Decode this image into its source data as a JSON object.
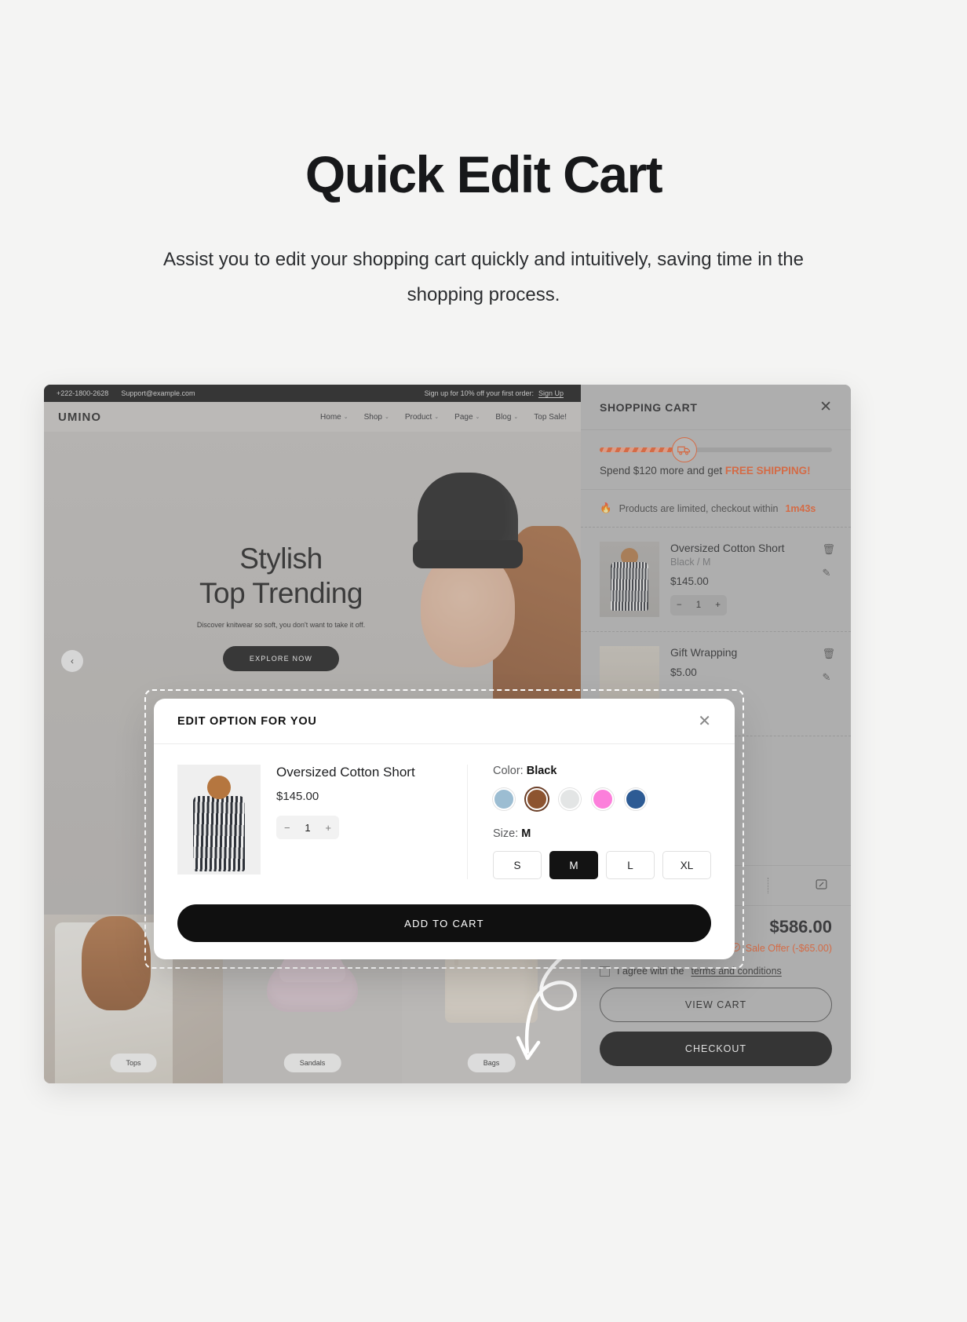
{
  "hero": {
    "title": "Quick Edit Cart",
    "subtitle": "Assist you to edit your shopping cart quickly and intuitively, saving time in the shopping process."
  },
  "site": {
    "topbar": {
      "phone": "+222-1800-2628",
      "email": "Support@example.com",
      "promo": "Sign up for 10% off your first order:",
      "promo_link": "Sign Up"
    },
    "logo": "UMINO",
    "nav": [
      {
        "label": "Home",
        "caret": "⌄"
      },
      {
        "label": "Shop",
        "caret": "⌄"
      },
      {
        "label": "Product",
        "caret": "⌄"
      },
      {
        "label": "Page",
        "caret": "⌄"
      },
      {
        "label": "Blog",
        "caret": "⌄"
      },
      {
        "label": "Top Sale!",
        "caret": ""
      }
    ],
    "hero_slide": {
      "line1": "Stylish",
      "line2": "Top Trending",
      "desc": "Discover knitwear so soft, you don't want to take it off.",
      "cta": "EXPLORE NOW",
      "prev_arrow": "‹"
    },
    "tiles": [
      {
        "label": "Tops"
      },
      {
        "label": "Sandals"
      },
      {
        "label": "Bags"
      }
    ]
  },
  "cart": {
    "title": "SHOPPING CART",
    "close_icon": "✕",
    "shipping": {
      "progress_pct": 34,
      "text_before": "Spend $120 more and get",
      "text_highlight": "FREE SHIPPING!",
      "truck_icon": "truck-icon"
    },
    "limited": {
      "emoji": "🔥",
      "text": "Products are limited, checkout within",
      "timer": "1m43s"
    },
    "items": [
      {
        "name": "Oversized Cotton Short",
        "variant": "Black / M",
        "price": "$145.00",
        "qty": "1",
        "minus": "−",
        "plus": "+",
        "remove_icon": "🗑",
        "edit_icon": "✎"
      },
      {
        "name": "Gift Wrapping",
        "variant": "",
        "price": "$5.00",
        "qty": "",
        "minus": "−",
        "plus": "+",
        "remove_icon": "🗑",
        "edit_icon": "✎"
      }
    ],
    "tools": [
      {
        "icon": "note-icon",
        "glyph": "✎"
      },
      {
        "icon": "box-icon",
        "glyph": "⬡"
      },
      {
        "icon": "coupon-icon",
        "glyph": "▣"
      }
    ],
    "total": "$586.00",
    "sale_offer": "Sale Offer (-$65.00)",
    "sale_icon": "%",
    "agree_text_before": "I agree with the",
    "agree_link": "terms and conditions",
    "view_cart": "VIEW CART",
    "checkout": "CHECKOUT"
  },
  "modal": {
    "title": "EDIT OPTION FOR YOU",
    "close_icon": "✕",
    "product": {
      "name": "Oversized Cotton Short",
      "price": "$145.00",
      "qty": "1",
      "minus": "−",
      "plus": "+"
    },
    "color": {
      "label": "Color:",
      "value": "Black",
      "swatches": [
        {
          "name": "light-blue",
          "hex": "#9cbdd2",
          "selected": false
        },
        {
          "name": "brown",
          "hex": "#8d5430",
          "selected": true
        },
        {
          "name": "white-gray",
          "hex": "#e3e5e5",
          "selected": false
        },
        {
          "name": "pink",
          "hex": "#fc7fdb",
          "selected": false
        },
        {
          "name": "navy-blue",
          "hex": "#2d5b94",
          "selected": false
        }
      ]
    },
    "size": {
      "label": "Size:",
      "value": "M",
      "options": [
        {
          "label": "S",
          "selected": false
        },
        {
          "label": "M",
          "selected": true
        },
        {
          "label": "L",
          "selected": false
        },
        {
          "label": "XL",
          "selected": false
        }
      ]
    },
    "add_to_cart": "ADD TO CART"
  },
  "colors": {
    "accent": "#ef5a24",
    "dark": "#101010",
    "page_bg": "#f4f4f3"
  }
}
